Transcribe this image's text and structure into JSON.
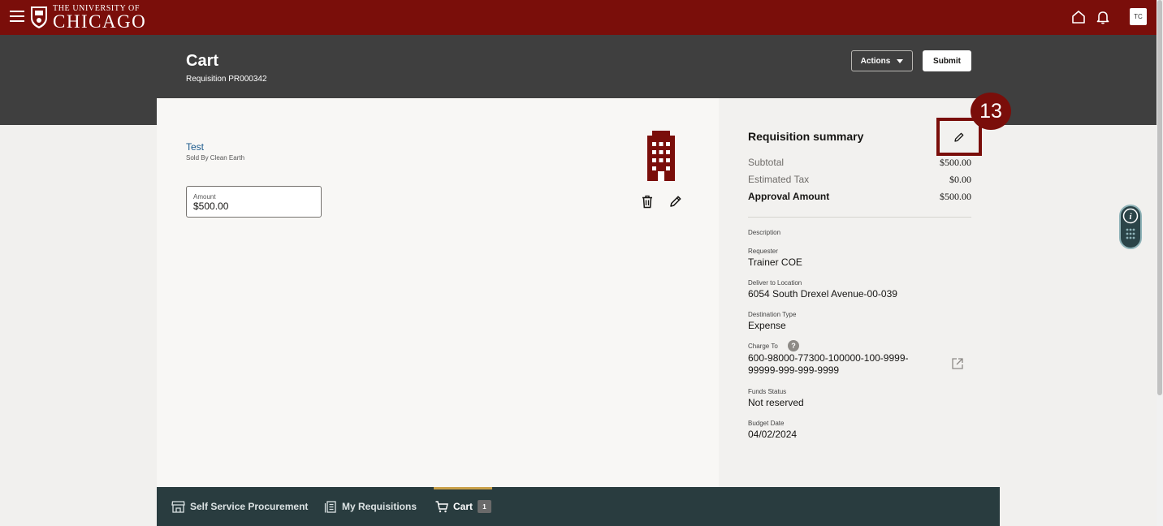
{
  "header": {
    "logo_small": "THE UNIVERSITY OF",
    "logo_big": "CHICAGO",
    "avatar_initials": "TC"
  },
  "page": {
    "title": "Cart",
    "subtitle": "Requisition PR000342",
    "actions_label": "Actions",
    "submit_label": "Submit"
  },
  "item": {
    "name": "Test",
    "seller": "Sold By Clean Earth",
    "amount_label": "Amount",
    "amount_value": "$500.00"
  },
  "summary": {
    "title": "Requisition summary",
    "callout_number": "13",
    "subtotal_label": "Subtotal",
    "subtotal_value": "$500.00",
    "tax_label": "Estimated Tax",
    "tax_value": "$0.00",
    "approval_label": "Approval Amount",
    "approval_value": "$500.00",
    "description_label": "Description",
    "requester_label": "Requester",
    "requester_value": "Trainer COE",
    "deliver_label": "Deliver to Location",
    "deliver_value": "6054 South Drexel Avenue-00-039",
    "destination_label": "Destination Type",
    "destination_value": "Expense",
    "charge_label": "Charge To",
    "charge_help": "?",
    "charge_value": "600-98000-77300-100000-100-9999-99999-999-999-9999",
    "funds_label": "Funds Status",
    "funds_value": "Not reserved",
    "budget_label": "Budget Date",
    "budget_value": "04/02/2024"
  },
  "bottom_nav": {
    "items": [
      {
        "label": "Self Service Procurement"
      },
      {
        "label": "My Requisitions"
      },
      {
        "label": "Cart",
        "count": "1"
      }
    ]
  },
  "colors": {
    "brand": "#7a0e0a",
    "header_band": "#3f3f3f",
    "bottom_nav": "#293c3f",
    "link": "#1b5a8c"
  }
}
